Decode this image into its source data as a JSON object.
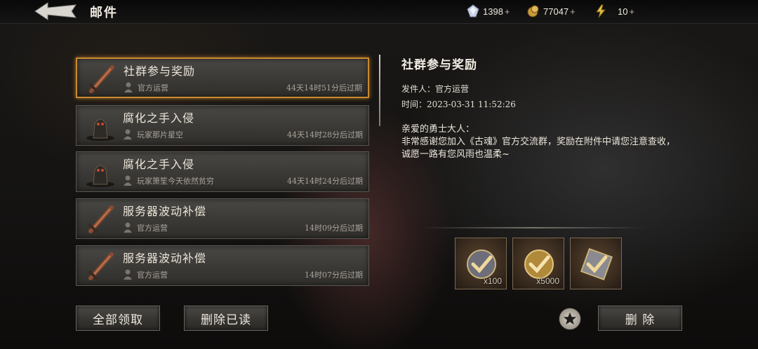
{
  "header": {
    "title": "邮件",
    "resources": [
      {
        "icon": "crystal-icon",
        "value": "1398",
        "plus": "+"
      },
      {
        "icon": "gold-coin-icon",
        "value": "77047",
        "plus": "+"
      },
      {
        "icon": "energy-bolt-icon",
        "value": "10",
        "plus": "+"
      }
    ]
  },
  "mails": [
    {
      "subject": "社群参与奖励",
      "sender": "官方运营",
      "expire": "44天14时51分后过期",
      "icon": "sword-icon",
      "selected": true
    },
    {
      "subject": "腐化之手入侵",
      "sender": "玩家那片星空",
      "expire": "44天14时28分后过期",
      "icon": "demon-icon",
      "selected": false
    },
    {
      "subject": "腐化之手入侵",
      "sender": "玩家箫笙今天依然贫穷",
      "expire": "44天14时24分后过期",
      "icon": "demon-icon",
      "selected": false
    },
    {
      "subject": "服务器波动补偿",
      "sender": "官方运营",
      "expire": "14时09分后过期",
      "icon": "sword-icon",
      "selected": false
    },
    {
      "subject": "服务器波动补偿",
      "sender": "官方运营",
      "expire": "14时07分后过期",
      "icon": "sword-icon",
      "selected": false
    }
  ],
  "buttons": {
    "claim_all": "全部领取",
    "delete_read": "删除已读",
    "delete": "删 除"
  },
  "detail": {
    "title": "社群参与奖励",
    "sender_label": "发件人：",
    "sender": "官方运营",
    "time_label": "时间：",
    "time": "2023-03-31 11:52:26",
    "greeting": "亲爱的勇士大人：",
    "body": "非常感谢您加入《古魂》官方交流群，奖励在附件中请您注意查收，诚愿一路有您风雨也温柔~"
  },
  "attachments": [
    {
      "icon": "crystal-reward-icon",
      "qty": "x100",
      "claimed": true
    },
    {
      "icon": "gold-reward-icon",
      "qty": "x5000",
      "claimed": true
    },
    {
      "icon": "scroll-reward-icon",
      "qty": "",
      "claimed": true
    }
  ],
  "colors": {
    "selected_border": "#c98a2f",
    "background": "#141312"
  }
}
